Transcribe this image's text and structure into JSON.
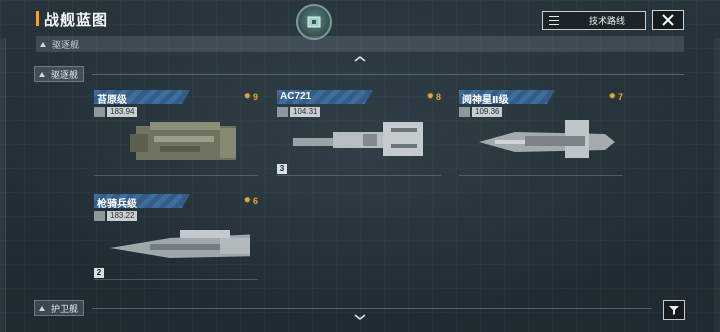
{
  "header": {
    "title": "战舰蓝图",
    "tech_route_label": "技术路线"
  },
  "section_label": "驱逐舰",
  "categories": [
    {
      "label": "驱逐舰"
    },
    {
      "label": "护卫舰"
    }
  ],
  "ships": [
    {
      "name": "苔原级",
      "cost": "9",
      "stat": "183.94",
      "count": ""
    },
    {
      "name": "AC721",
      "cost": "8",
      "stat": "104.31",
      "count": "3"
    },
    {
      "name": "阋神星Ⅱ级",
      "cost": "7",
      "stat": "109.36",
      "count": ""
    },
    {
      "name": "枪骑兵级",
      "cost": "6",
      "stat": "183.22",
      "count": "2"
    }
  ],
  "colors": {
    "accent": "#f0a23a",
    "name_bar": "#3f6d9d",
    "cost": "#e7a53b"
  },
  "icons": [
    "close-icon",
    "list-icon",
    "gear-icon",
    "filter-icon",
    "chevron-up-icon",
    "chevron-down-icon"
  ]
}
